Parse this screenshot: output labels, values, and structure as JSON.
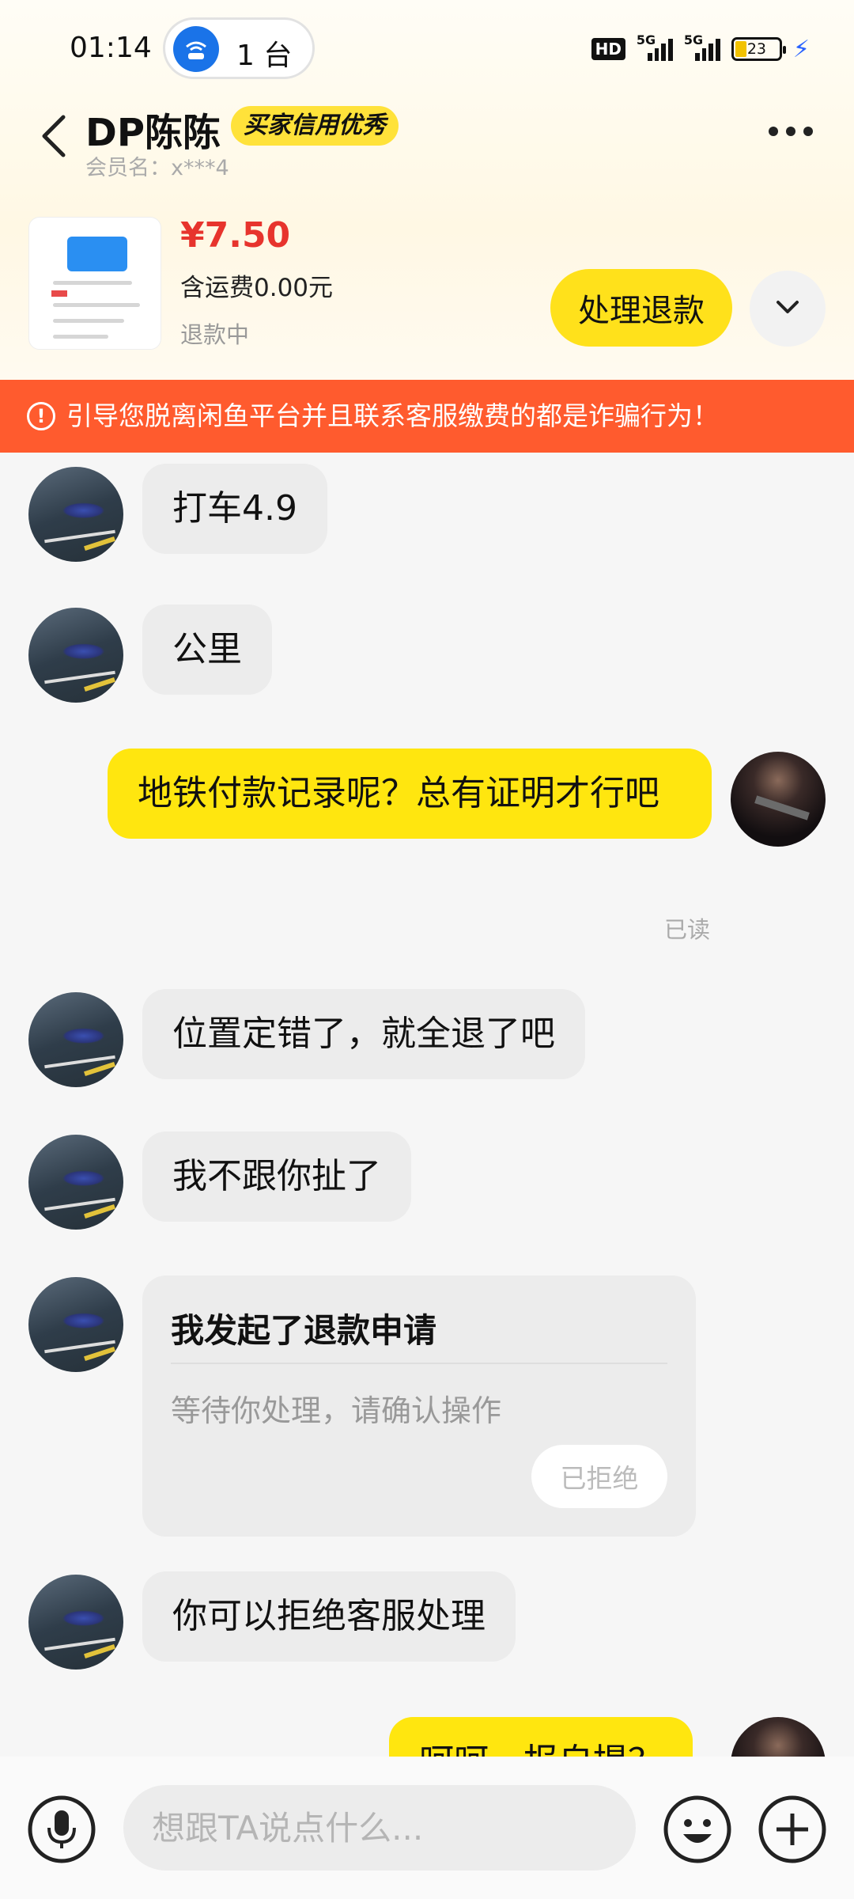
{
  "status_bar": {
    "time": "01:14",
    "hotspot_count": "1 台",
    "hd_label": "HD",
    "network_1": "5G",
    "network_2": "5G",
    "battery": "23"
  },
  "header": {
    "title": "DP陈陈",
    "badge": "买家信用优秀",
    "member_label": "会员名：x***4"
  },
  "product": {
    "price": "¥7.50",
    "shipping": "含运费0.00元",
    "status": "退款中",
    "refund_button": "处理退款"
  },
  "warning": {
    "text": "引导您脱离闲鱼平台并且联系客服缴费的都是诈骗行为！"
  },
  "messages": [
    {
      "side": "in",
      "text": "打车4.9"
    },
    {
      "side": "in",
      "text": "公里"
    },
    {
      "side": "out",
      "text": "地铁付款记录呢？总有证明才行吧",
      "read": "已读"
    },
    {
      "side": "in",
      "text": "位置定错了，就全退了吧"
    },
    {
      "side": "in",
      "text": "我不跟你扯了"
    },
    {
      "side": "in",
      "type": "card",
      "title": "我发起了退款申请",
      "subtitle": "等待你处理，请确认操作",
      "button": "已拒绝"
    },
    {
      "side": "in",
      "text": "你可以拒绝客服处理"
    },
    {
      "side": "out",
      "text": "呵呵，报自提？"
    }
  ],
  "input": {
    "placeholder": "想跟TA说点什么..."
  },
  "colors": {
    "accent_yellow": "#ffe11b",
    "warning_orange": "#ff5b2e",
    "price_red": "#e7342d"
  }
}
